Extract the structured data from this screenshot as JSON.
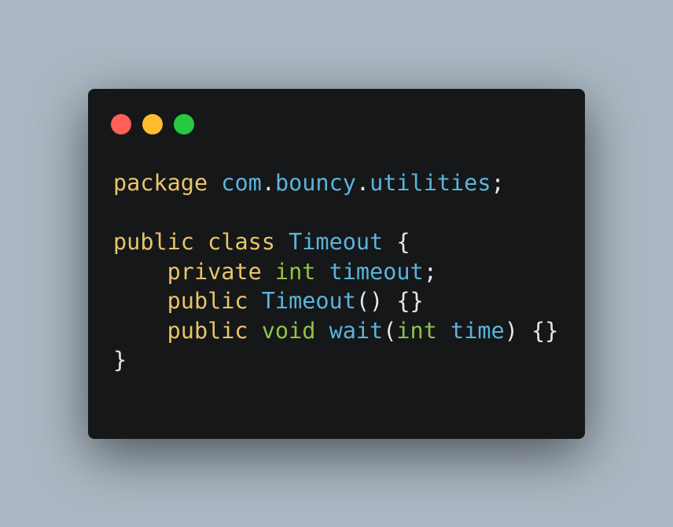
{
  "colors": {
    "background": "#abb8c3",
    "window": "#151718",
    "close": "#ff5f56",
    "minimize": "#ffbd2e",
    "maximize": "#27c93f",
    "keyword": "#e8c46a",
    "type": "#8fc249",
    "identifier": "#5cb3db",
    "punctuation": "#e6e6e6"
  },
  "window_controls": [
    "close-dot",
    "minimize-dot",
    "maximize-dot"
  ],
  "code": {
    "lines": [
      [
        {
          "text": "package",
          "kind": "kw"
        },
        {
          "text": " ",
          "kind": "pn"
        },
        {
          "text": "com",
          "kind": "id"
        },
        {
          "text": ".",
          "kind": "pn"
        },
        {
          "text": "bouncy",
          "kind": "id"
        },
        {
          "text": ".",
          "kind": "pn"
        },
        {
          "text": "utilities",
          "kind": "id"
        },
        {
          "text": ";",
          "kind": "pn"
        }
      ],
      [],
      [
        {
          "text": "public",
          "kind": "kw"
        },
        {
          "text": " ",
          "kind": "pn"
        },
        {
          "text": "class",
          "kind": "kw"
        },
        {
          "text": " ",
          "kind": "pn"
        },
        {
          "text": "Timeout",
          "kind": "id"
        },
        {
          "text": " {",
          "kind": "pn"
        }
      ],
      [
        {
          "text": "    ",
          "kind": "pn"
        },
        {
          "text": "private",
          "kind": "kw"
        },
        {
          "text": " ",
          "kind": "pn"
        },
        {
          "text": "int",
          "kind": "ty"
        },
        {
          "text": " ",
          "kind": "pn"
        },
        {
          "text": "timeout",
          "kind": "id"
        },
        {
          "text": ";",
          "kind": "pn"
        }
      ],
      [
        {
          "text": "    ",
          "kind": "pn"
        },
        {
          "text": "public",
          "kind": "kw"
        },
        {
          "text": " ",
          "kind": "pn"
        },
        {
          "text": "Timeout",
          "kind": "id"
        },
        {
          "text": "() {}",
          "kind": "pn"
        }
      ],
      [
        {
          "text": "    ",
          "kind": "pn"
        },
        {
          "text": "public",
          "kind": "kw"
        },
        {
          "text": " ",
          "kind": "pn"
        },
        {
          "text": "void",
          "kind": "ty"
        },
        {
          "text": " ",
          "kind": "pn"
        },
        {
          "text": "wait",
          "kind": "id"
        },
        {
          "text": "(",
          "kind": "pn"
        },
        {
          "text": "int",
          "kind": "ty"
        },
        {
          "text": " ",
          "kind": "pn"
        },
        {
          "text": "time",
          "kind": "id"
        },
        {
          "text": ") {}",
          "kind": "pn"
        }
      ],
      [
        {
          "text": "}",
          "kind": "pn"
        }
      ]
    ]
  }
}
